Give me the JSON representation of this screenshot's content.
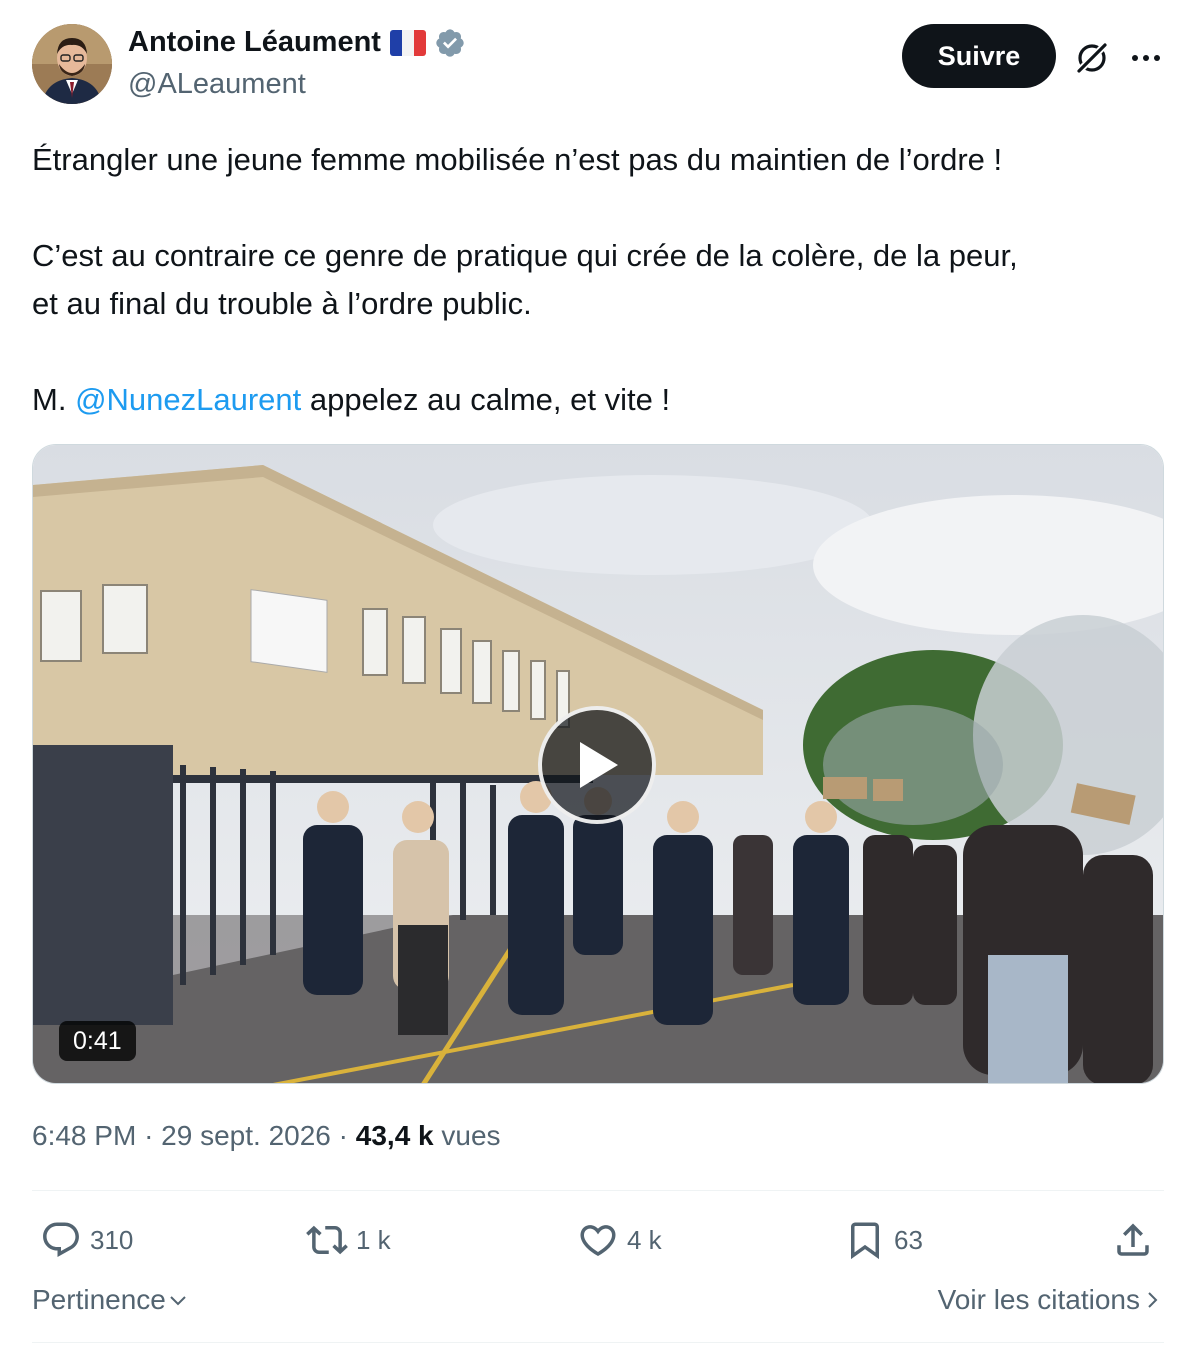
{
  "author": {
    "display_name": "Antoine Léaument",
    "flag_emoji": "🇫🇷",
    "handle": "@ALeaument",
    "verified": true,
    "avatar_icon": "avatar-photo"
  },
  "header": {
    "follow_label": "Suivre",
    "grok_icon": "grok-icon",
    "more_icon": "more-icon"
  },
  "post": {
    "line1": "Étrangler une jeune femme mobilisée n’est pas du maintien de l’ordre !",
    "line2": "C’est au contraire ce genre de pratique qui crée de la colère, de la peur,",
    "line3": "et au final du trouble à l’ordre public.",
    "line4_prefix": "M.",
    "mention": "@NunezLaurent",
    "line4_suffix": "appelez au calme, et vite !"
  },
  "media": {
    "type": "video",
    "duration": "0:41",
    "play_icon": "play-icon"
  },
  "meta": {
    "time": "6:48 PM",
    "separator": "·",
    "date": "29 sept. 2026",
    "views_count": "43,4 k",
    "views_label": "vues"
  },
  "actions": {
    "replies": "310",
    "reposts": "1 k",
    "likes": "4 k",
    "bookmarks": "63"
  },
  "footer": {
    "sort_label": "Pertinence",
    "quotes_label": "Voir les citations"
  },
  "colors": {
    "text": "#0f1419",
    "secondary": "#536471",
    "link": "#1d9bf0",
    "verified": "#829aab",
    "button_bg": "#0f1419"
  }
}
